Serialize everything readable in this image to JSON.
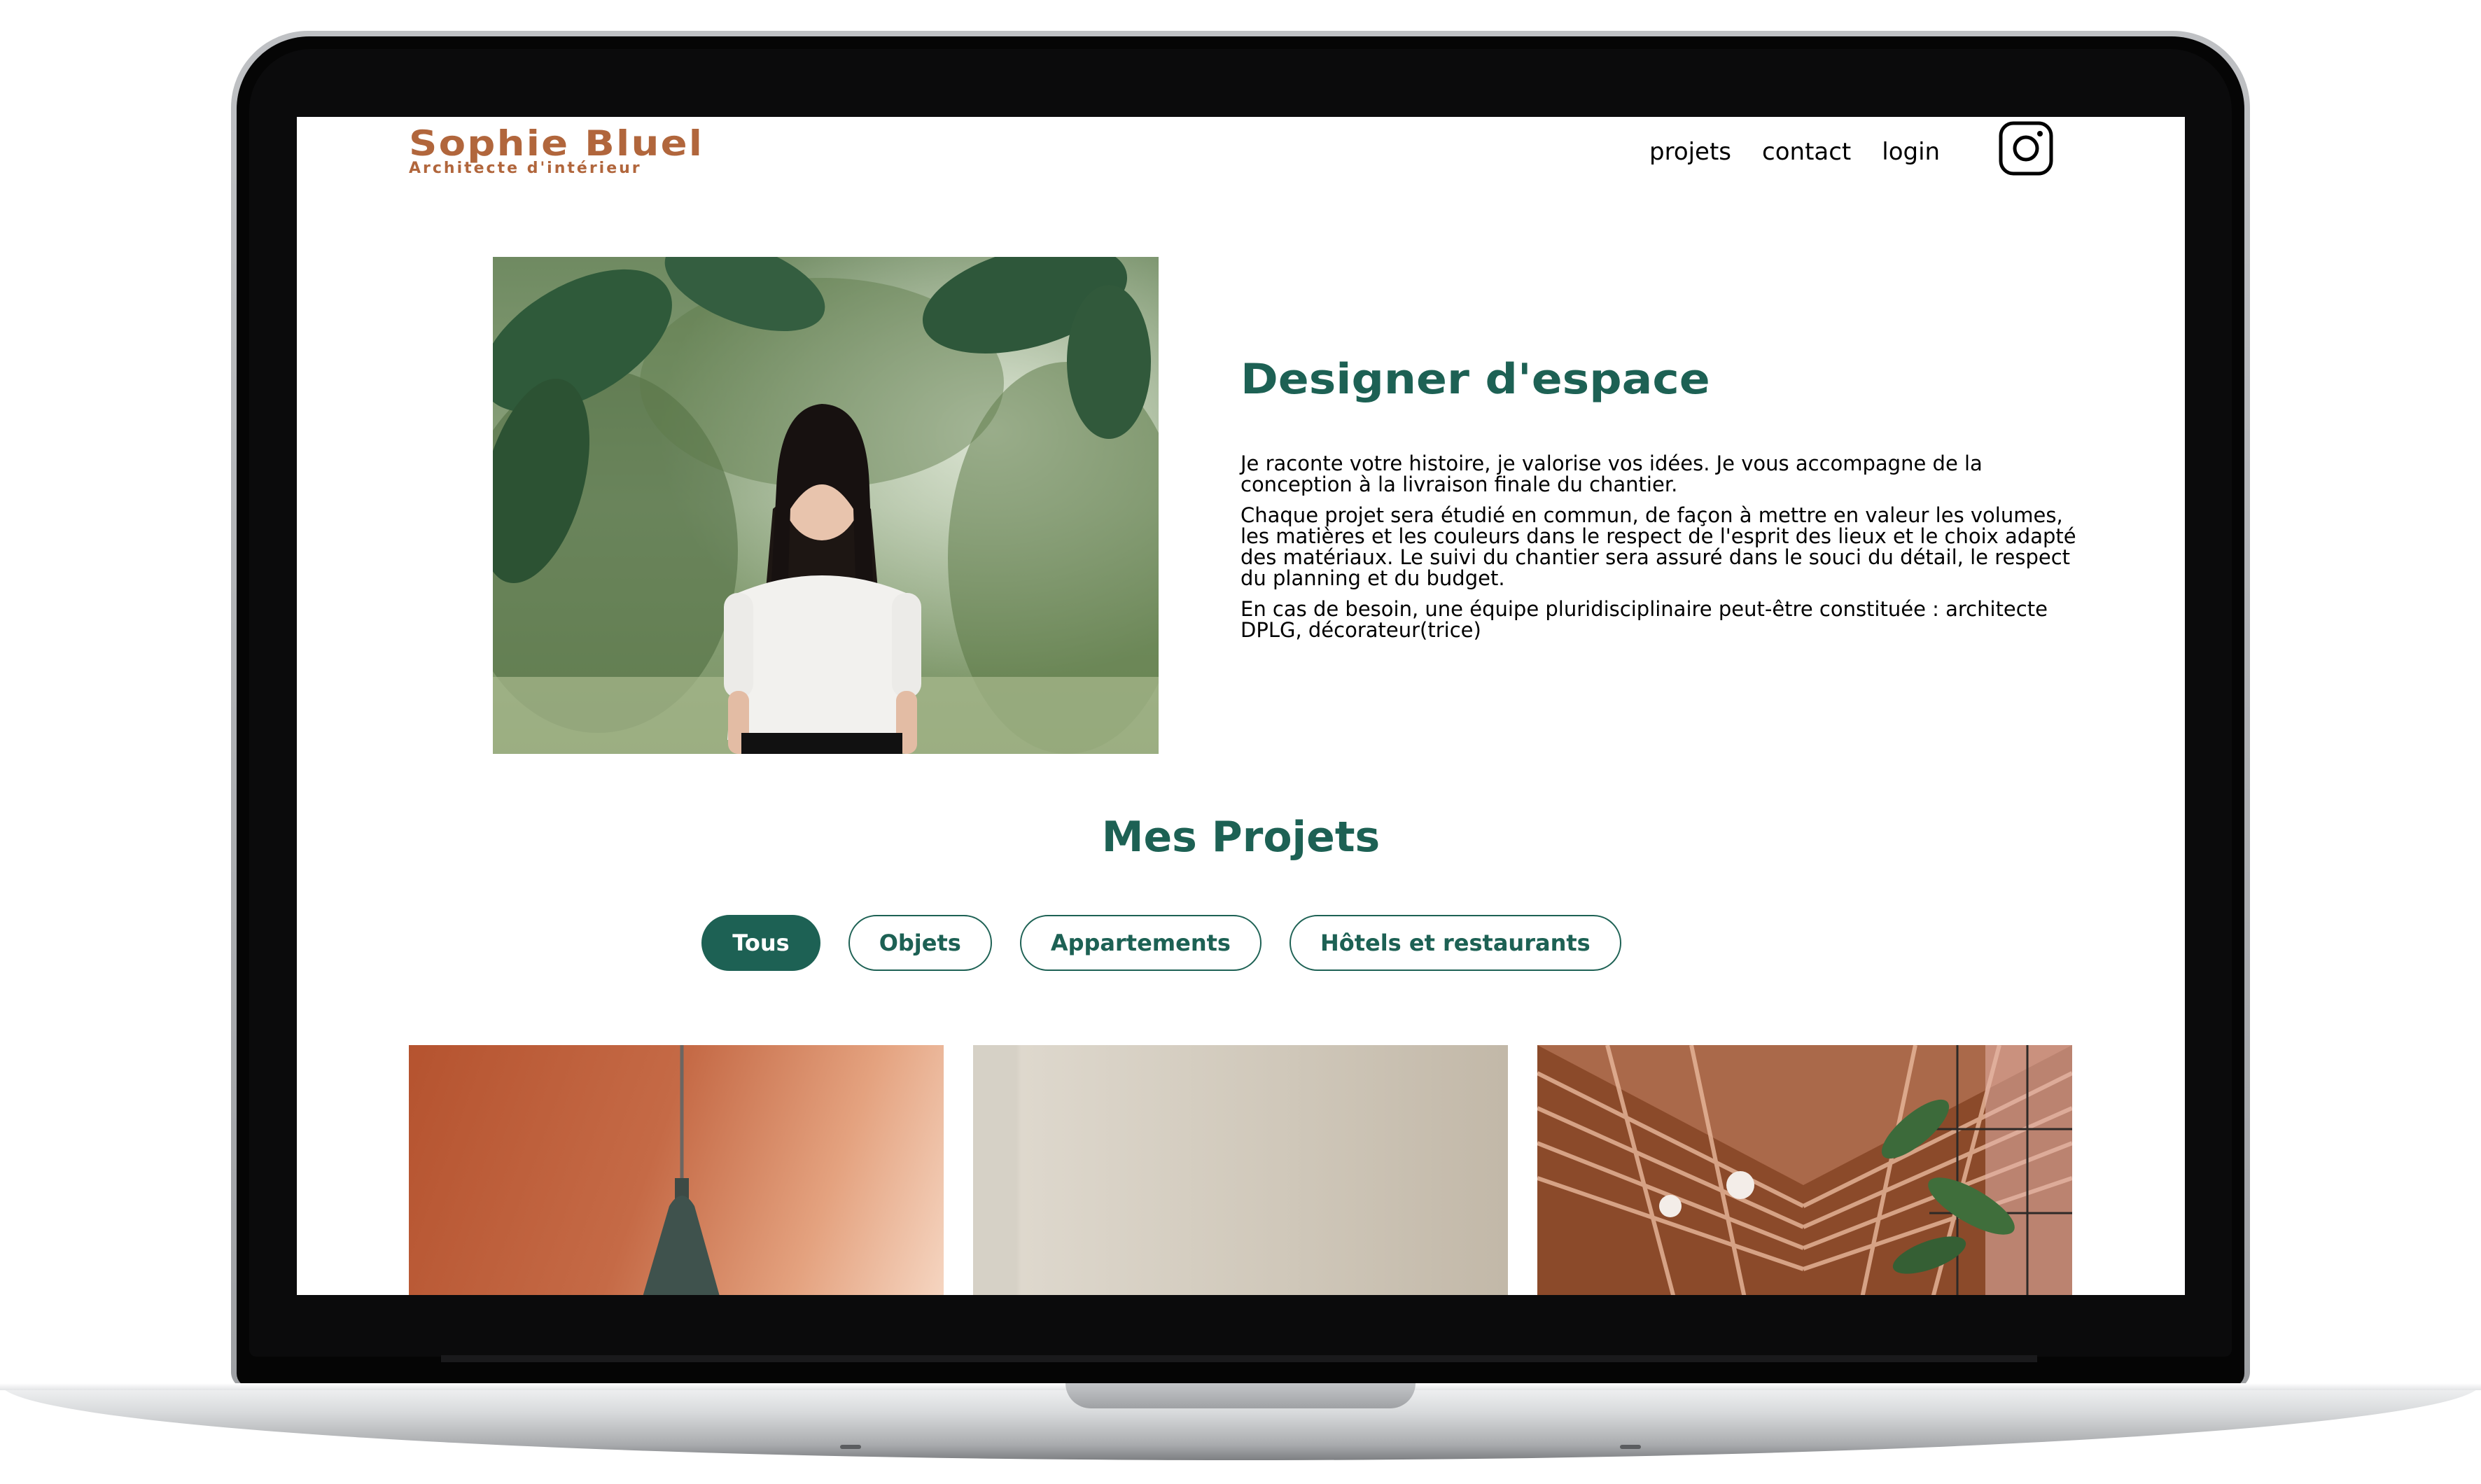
{
  "site": {
    "name": "Sophie Bluel",
    "tagline": "Architecte d'intérieur"
  },
  "nav": {
    "items": [
      "projets",
      "contact",
      "login"
    ],
    "social_icon": "instagram-icon"
  },
  "intro": {
    "title": "Designer d'espace",
    "paragraphs": [
      "Je raconte votre histoire, je valorise vos idées. Je vous accompagne de la conception à la livraison finale du chantier.",
      "Chaque projet sera étudié en commun, de façon à mettre en valeur les volumes, les matières et les couleurs dans le respect de l'esprit des lieux et le choix adapté des matériaux. Le suivi du chantier sera assuré dans le souci du détail, le respect du planning et du budget.",
      "En cas de besoin, une équipe pluridisciplinaire peut-être constituée : architecte DPLG, décorateur(trice)"
    ]
  },
  "projects": {
    "title": "Mes Projets",
    "filters": [
      "Tous",
      "Objets",
      "Appartements",
      "Hôtels et restaurants"
    ],
    "active_filter": "Tous"
  },
  "colors": {
    "brand": "#b1663c",
    "accent": "#1d6154",
    "text": "#000000",
    "background": "#ffffff"
  }
}
